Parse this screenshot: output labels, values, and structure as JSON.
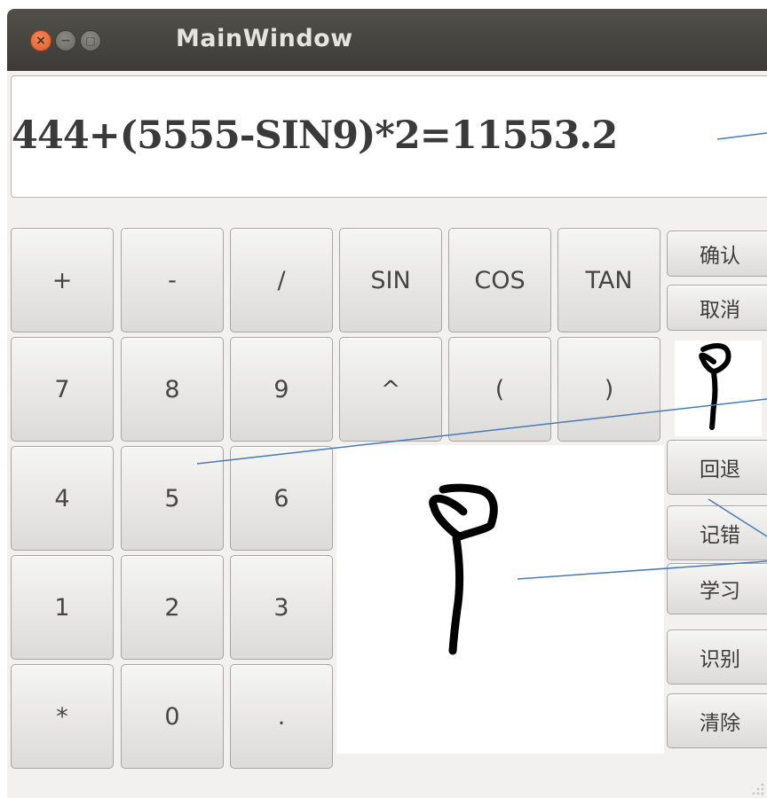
{
  "window": {
    "title": "MainWindow",
    "controls": {
      "close": "×",
      "minimize": "−",
      "maximize": "□"
    }
  },
  "display": {
    "expression": "444+(5555-SIN9)*2=11553.2"
  },
  "keypad": {
    "row1": [
      "+",
      "-",
      "/",
      "SIN",
      "COS",
      "TAN"
    ],
    "row2": [
      "7",
      "8",
      "9",
      "^",
      "(",
      ")"
    ],
    "row3": [
      "4",
      "5",
      "6"
    ],
    "row4": [
      "1",
      "2",
      "3"
    ],
    "row5": [
      "*",
      "0",
      "."
    ]
  },
  "side_buttons": {
    "confirm": "确认",
    "cancel": "取消",
    "back": "回退",
    "record_error": "记错",
    "learn": "学习",
    "recognize": "识别",
    "clear": "清除"
  },
  "colors": {
    "titlebar": "#3d3b37",
    "close_button": "#e0622e",
    "window_bg": "#f2f1f0",
    "annotation_line": "#4a7ab5",
    "ink": "#000000"
  }
}
